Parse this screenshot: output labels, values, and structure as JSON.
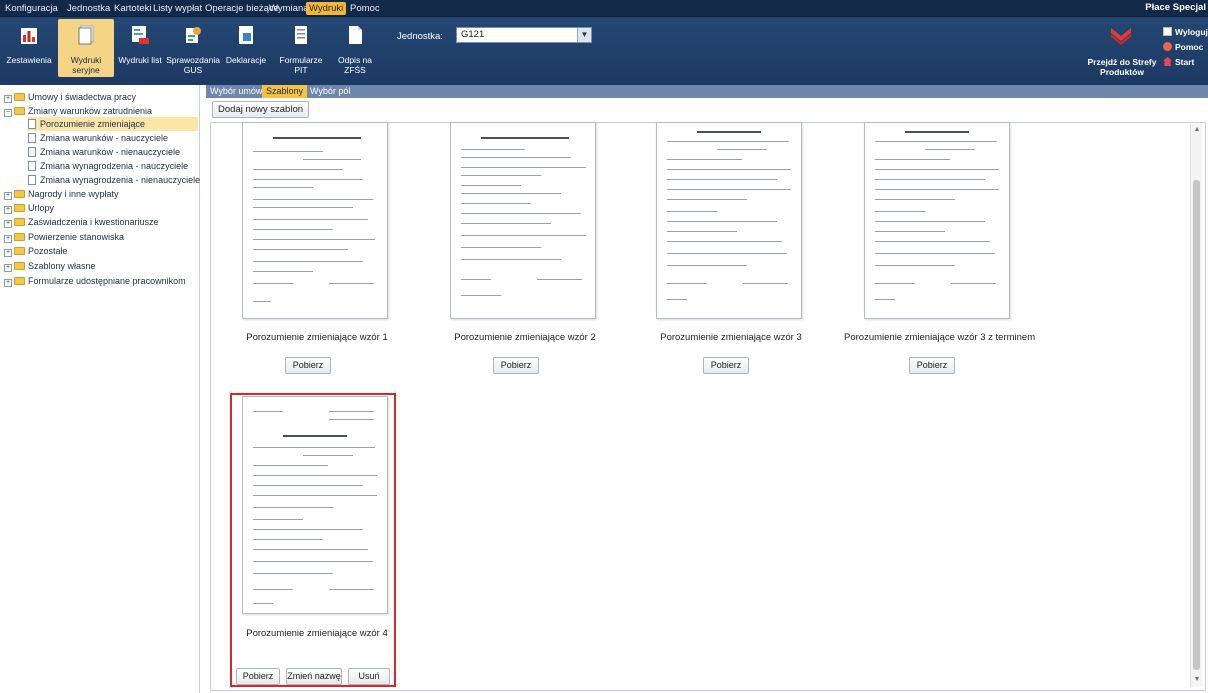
{
  "menu": {
    "items": [
      "Konfiguracja",
      "Jednostka",
      "Kartoteki",
      "Listy wypłat",
      "Operacje bieżące",
      "Wymiana",
      "Wydruki",
      "Pomoc"
    ],
    "active": "Wydruki",
    "app_title": "Płace Specjal"
  },
  "toolbar": {
    "buttons": [
      {
        "label": "Zestawienia",
        "icon": "bar-chart-icon"
      },
      {
        "label": "Wydruki seryjne",
        "icon": "documents-icon"
      },
      {
        "label": "Wydruki list",
        "icon": "pdf-list-icon"
      },
      {
        "label": "Sprawozdania GUS",
        "icon": "gus-report-icon"
      },
      {
        "label": "Deklaracje",
        "icon": "declaration-icon"
      },
      {
        "label": "Formularze PIT",
        "icon": "pit-form-icon"
      },
      {
        "label": "Odpis na ZFŚS",
        "icon": "zfss-icon"
      }
    ],
    "active": "Wydruki seryjne"
  },
  "jednostka": {
    "label": "Jednostka:",
    "value": "G121"
  },
  "right_panel": {
    "strefy_label": "Przejdź do Strefy Produktów",
    "logout": "Wyloguj s",
    "help": "Pomoc",
    "start": "Start"
  },
  "tree": {
    "items": [
      {
        "label": "Umowy i świadectwa pracy",
        "level": 0
      },
      {
        "label": "Zmiany warunków zatrudnienia",
        "level": 0
      },
      {
        "label": "Porozumienie zmieniające",
        "level": 1,
        "selected": true
      },
      {
        "label": "Zmiana warunków - nauczyciele",
        "level": 1
      },
      {
        "label": "Zmiana warunków - nienauczyciele",
        "level": 1
      },
      {
        "label": "Zmiana wynagrodzenia - nauczyciele",
        "level": 1
      },
      {
        "label": "Zmiana wynagrodzenia - nienauczyciele",
        "level": 1
      },
      {
        "label": "Nagrody i inne wypłaty",
        "level": 0
      },
      {
        "label": "Urlopy",
        "level": 0
      },
      {
        "label": "Zaświadczenia i kwestionariusze",
        "level": 0
      },
      {
        "label": "Powierzenie stanowiska",
        "level": 0
      },
      {
        "label": "Pozostałe",
        "level": 0
      },
      {
        "label": "Szablony własne",
        "level": 0
      },
      {
        "label": "Formularze udostępniane pracownikom",
        "level": 0
      }
    ]
  },
  "tabs": {
    "items": [
      "Wybór umów",
      "Szablony",
      "Wybór pól"
    ],
    "active": "Szablony"
  },
  "add_template": "Dodaj nowy szablon",
  "templates": [
    {
      "name": "Porozumienie zmieniające wzór 1",
      "buttons": [
        "Pobierz"
      ]
    },
    {
      "name": "Porozumienie zmieniające wzór 2",
      "buttons": [
        "Pobierz"
      ]
    },
    {
      "name": "Porozumienie zmieniające wzór 3",
      "buttons": [
        "Pobierz"
      ]
    },
    {
      "name": "Porozumienie zmieniające wzór 3 z terminem",
      "buttons": [
        "Pobierz"
      ]
    },
    {
      "name": "Porozumienie zmieniające wzór 4",
      "buttons": [
        "Pobierz",
        "Zmień nazwę",
        "Usuń"
      ]
    }
  ],
  "colors": {
    "header": "#1f3f6a",
    "accent": "#f5c242",
    "highlight": "#e02525"
  }
}
